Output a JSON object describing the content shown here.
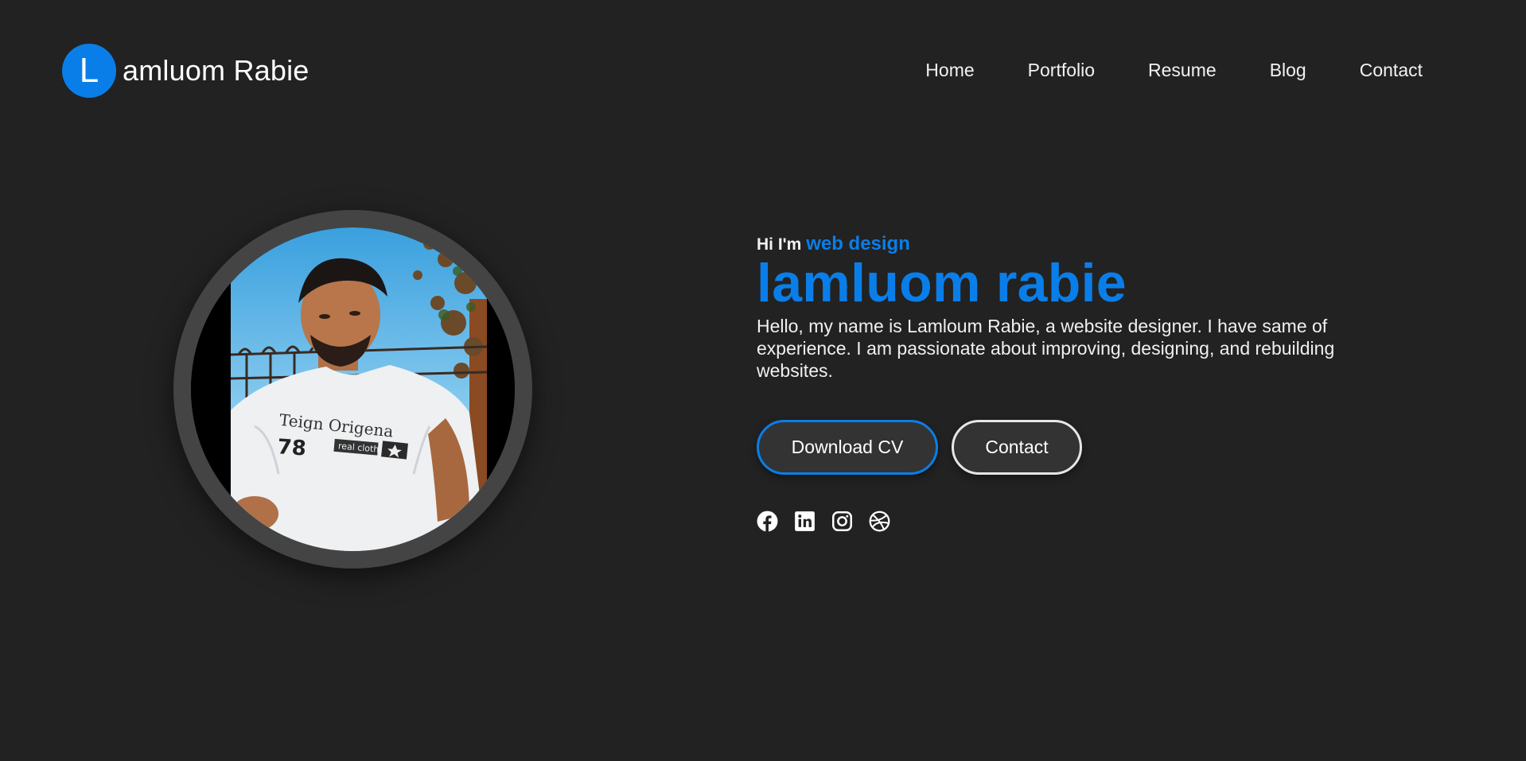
{
  "header": {
    "logo_letter": "L",
    "logo_text": "amluom Rabie",
    "nav": [
      "Home",
      "Portfolio",
      "Resume",
      "Blog",
      "Contact"
    ]
  },
  "hero": {
    "greeting_prefix": "Hi I'm",
    "role": "web design",
    "name": "lamluom rabie",
    "bio": "Hello, my name is Lamloum Rabie, a website designer. I have same of experience. I am passionate about improving, designing, and rebuilding websites.",
    "download_label": "Download CV",
    "contact_label": "Contact",
    "tshirt_line1": "Teign Origena",
    "tshirt_line2": "78",
    "tshirt_line3": "real clothes"
  },
  "socials": [
    "facebook-icon",
    "linkedin-icon",
    "instagram-icon",
    "dribbble-icon"
  ],
  "colors": {
    "background": "#222222",
    "accent": "#0a7ee8",
    "button_bg": "#333333",
    "ring": "#444444"
  }
}
